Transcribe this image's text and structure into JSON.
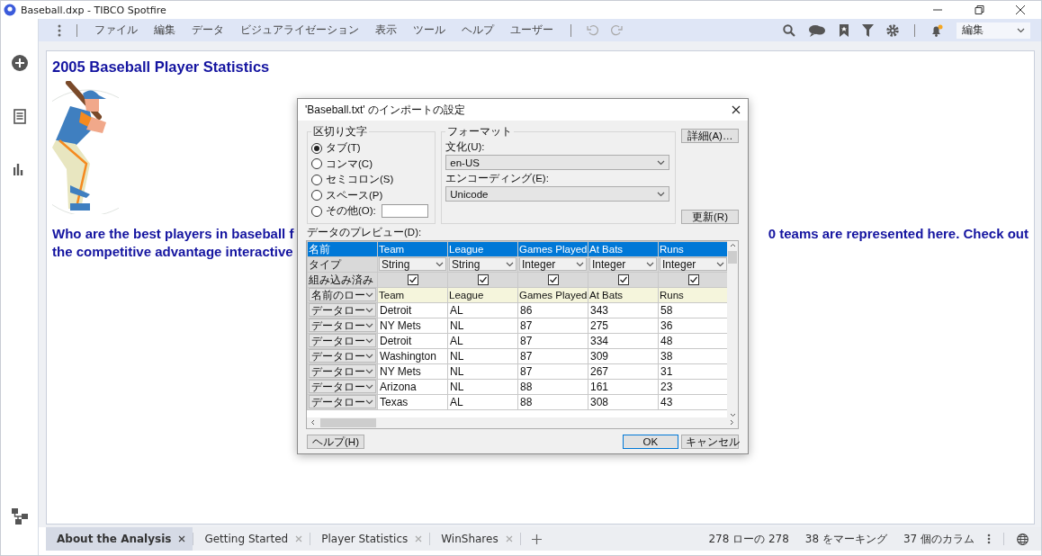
{
  "window": {
    "title": "Baseball.dxp - TIBCO Spotfire"
  },
  "menu": [
    "ファイル",
    "編集",
    "データ",
    "ビジュアライゼーション",
    "表示",
    "ツール",
    "ヘルプ",
    "ユーザー"
  ],
  "mode_dropdown": {
    "value": "編集"
  },
  "page": {
    "title": "2005 Baseball Player Statistics",
    "line_1_left": "Who are the best players in baseball f",
    "line_1_right": "0 teams are represented here. Check out",
    "line_2_left": "the competitive advantage interactive"
  },
  "dialog": {
    "title": "'Baseball.txt' のインポートの設定",
    "delimiter": {
      "label": "区切り文字",
      "options": [
        {
          "label": "タブ(T)",
          "selected": true
        },
        {
          "label": "コンマ(C)",
          "selected": false
        },
        {
          "label": "セミコロン(S)",
          "selected": false
        },
        {
          "label": "スペース(P)",
          "selected": false
        },
        {
          "label": "その他(O):",
          "selected": false
        }
      ]
    },
    "format": {
      "label": "フォーマット",
      "culture_label": "文化(U):",
      "culture_value": "en-US",
      "encoding_label": "エンコーディング(E):",
      "encoding_value": "Unicode"
    },
    "advanced_button": "詳細(A)…",
    "refresh_button": "更新(R)",
    "preview_label": "データのプレビュー(D):",
    "preview": {
      "name_label": "名前",
      "columns": [
        "Team",
        "League",
        "Games Played",
        "At Bats",
        "Runs"
      ],
      "type_label": "タイプ",
      "types": [
        "String",
        "String",
        "Integer",
        "Integer",
        "Integer"
      ],
      "include_label": "組み込み済み",
      "included": [
        true,
        true,
        true,
        true,
        true
      ],
      "name_row": {
        "label": "名前のロー",
        "cells": [
          "Team",
          "League",
          "Games Played",
          "At Bats",
          "Runs"
        ]
      },
      "rows": [
        {
          "label": "データロー",
          "cells": [
            "Detroit",
            "AL",
            "86",
            "343",
            "58"
          ]
        },
        {
          "label": "データロー",
          "cells": [
            "NY Mets",
            "NL",
            "87",
            "275",
            "36"
          ]
        },
        {
          "label": "データロー",
          "cells": [
            "Detroit",
            "AL",
            "87",
            "334",
            "48"
          ]
        },
        {
          "label": "データロー",
          "cells": [
            "Washington",
            "NL",
            "87",
            "309",
            "38"
          ]
        },
        {
          "label": "データロー",
          "cells": [
            "NY Mets",
            "NL",
            "87",
            "267",
            "31"
          ]
        },
        {
          "label": "データロー",
          "cells": [
            "Arizona",
            "NL",
            "88",
            "161",
            "23"
          ]
        },
        {
          "label": "データロー",
          "cells": [
            "Texas",
            "AL",
            "88",
            "308",
            "43"
          ]
        }
      ]
    },
    "help_button": "ヘルプ(H)",
    "ok_button": "OK",
    "cancel_button": "キャンセル"
  },
  "tabs": [
    {
      "label": "About the Analysis",
      "selected": true
    },
    {
      "label": "Getting Started",
      "selected": false
    },
    {
      "label": "Player Statistics",
      "selected": false
    },
    {
      "label": "WinShares",
      "selected": false
    }
  ],
  "status": [
    "278 ローの 278",
    "38 をマーキング",
    "37 個のカラム"
  ]
}
